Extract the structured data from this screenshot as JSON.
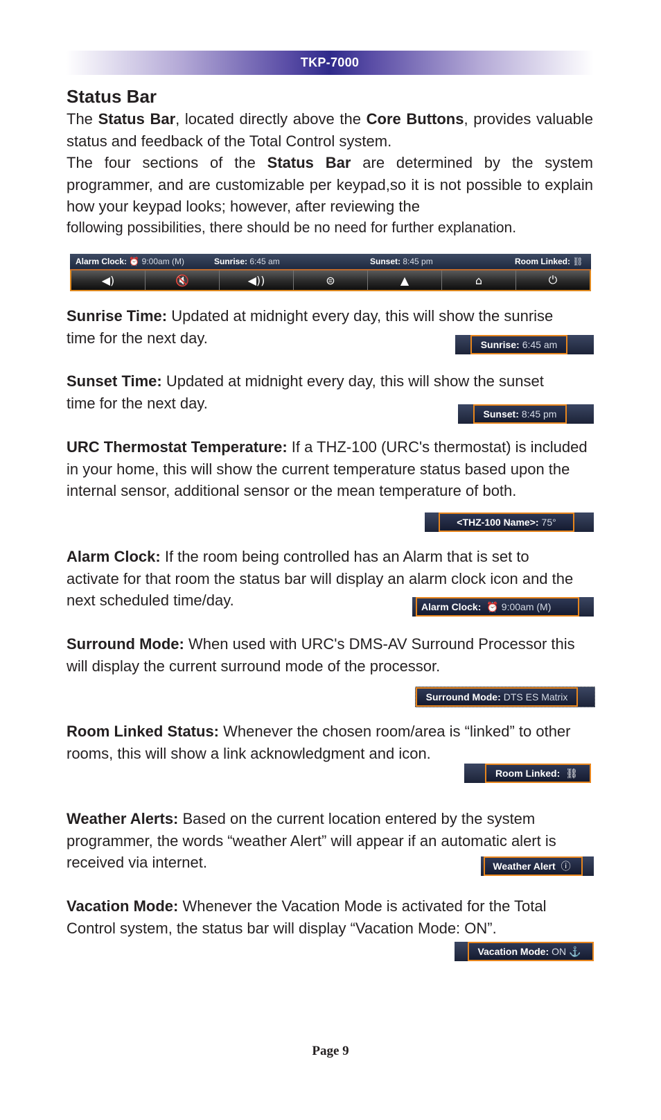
{
  "header": {
    "title": "TKP-7000"
  },
  "section_title": "Status Bar",
  "intro": {
    "p1_a": "The ",
    "p1_b1": "Status Bar",
    "p1_c": ", located directly above the ",
    "p1_b2": "Core Buttons",
    "p1_d": ", provides valuable status and feedback of the Total Control system.",
    "p2_a": "The four sections of the ",
    "p2_b": "Status Bar",
    "p2_c": " are determined by the system programmer, and are customizable per keypad,so it is not possible to explain how your keypad looks; however, after reviewing the",
    "p2_d": "following possibilities, there should be no need for further explanation."
  },
  "status_bar": {
    "alarm_label": "Alarm Clock:",
    "alarm_value": "9:00am (M)",
    "sunrise_label": "Sunrise:",
    "sunrise_value": "6:45 am",
    "sunset_label": "Sunset:",
    "sunset_value": "8:45 pm",
    "room_label": "Room Linked:",
    "buttons": [
      "volume-down",
      "mute",
      "volume-up",
      "menu",
      "up-arrow",
      "home",
      "power"
    ],
    "button_glyphs": [
      "◀)",
      "🔇",
      "◀))",
      "⊜",
      "▲",
      "⌂",
      "⏻"
    ]
  },
  "items": [
    {
      "title": "Sunrise Time:",
      "text": " Updated at midnight every day, this will show the sunrise time for the next day.",
      "badge_label": "Sunrise:",
      "badge_value": "6:45 am"
    },
    {
      "title": "Sunset Time:",
      "text": " Updated at midnight every day, this will show the sunset time for the next day.",
      "badge_label": "Sunset:",
      "badge_value": "8:45 pm"
    },
    {
      "title": "URC Thermostat Temperature:",
      "text": " If a THZ-100 (URC's thermostat) is included in your home, this will show the current temperature status based upon the internal sensor, additional sensor or the mean temperature of both.",
      "badge_label": "<THZ-100 Name>:",
      "badge_value": "75°"
    },
    {
      "title": "Alarm Clock:",
      "text": " If the room being controlled has an Alarm that is set to activate for that room the status bar will display an alarm clock icon and the next scheduled time/day.",
      "badge_label": "Alarm Clock:",
      "badge_value": "9:00am (M)"
    },
    {
      "title": "Surround Mode:",
      "text": " When used with URC's DMS-AV Surround Processor this will display the current surround mode of the processor.",
      "badge_label": "Surround Mode:",
      "badge_value": "DTS ES Matrix"
    },
    {
      "title": "Room Linked Status:",
      "text": " Whenever the chosen room/area is “linked” to other rooms, this will show a link acknowledgment and icon.",
      "badge_label": "Room Linked:",
      "badge_value": ""
    },
    {
      "title": "Weather Alerts:",
      "text": " Based on the current location entered by the system programmer, the words “weather Alert” will appear if an automatic alert is received via internet.",
      "badge_label": "Weather Alert",
      "badge_value": ""
    },
    {
      "title": "Vacation Mode:",
      "text": " Whenever the Vacation Mode is activated for the Total Control system, the status bar will display “Vacation Mode: ON”.",
      "badge_label": "Vacation Mode:",
      "badge_value": "ON"
    }
  ],
  "footer": {
    "page": "Page 9"
  },
  "colors": {
    "header_band": "#2f2a8a",
    "badge_border": "#e8851c",
    "badge_bg": "#1c2338"
  }
}
